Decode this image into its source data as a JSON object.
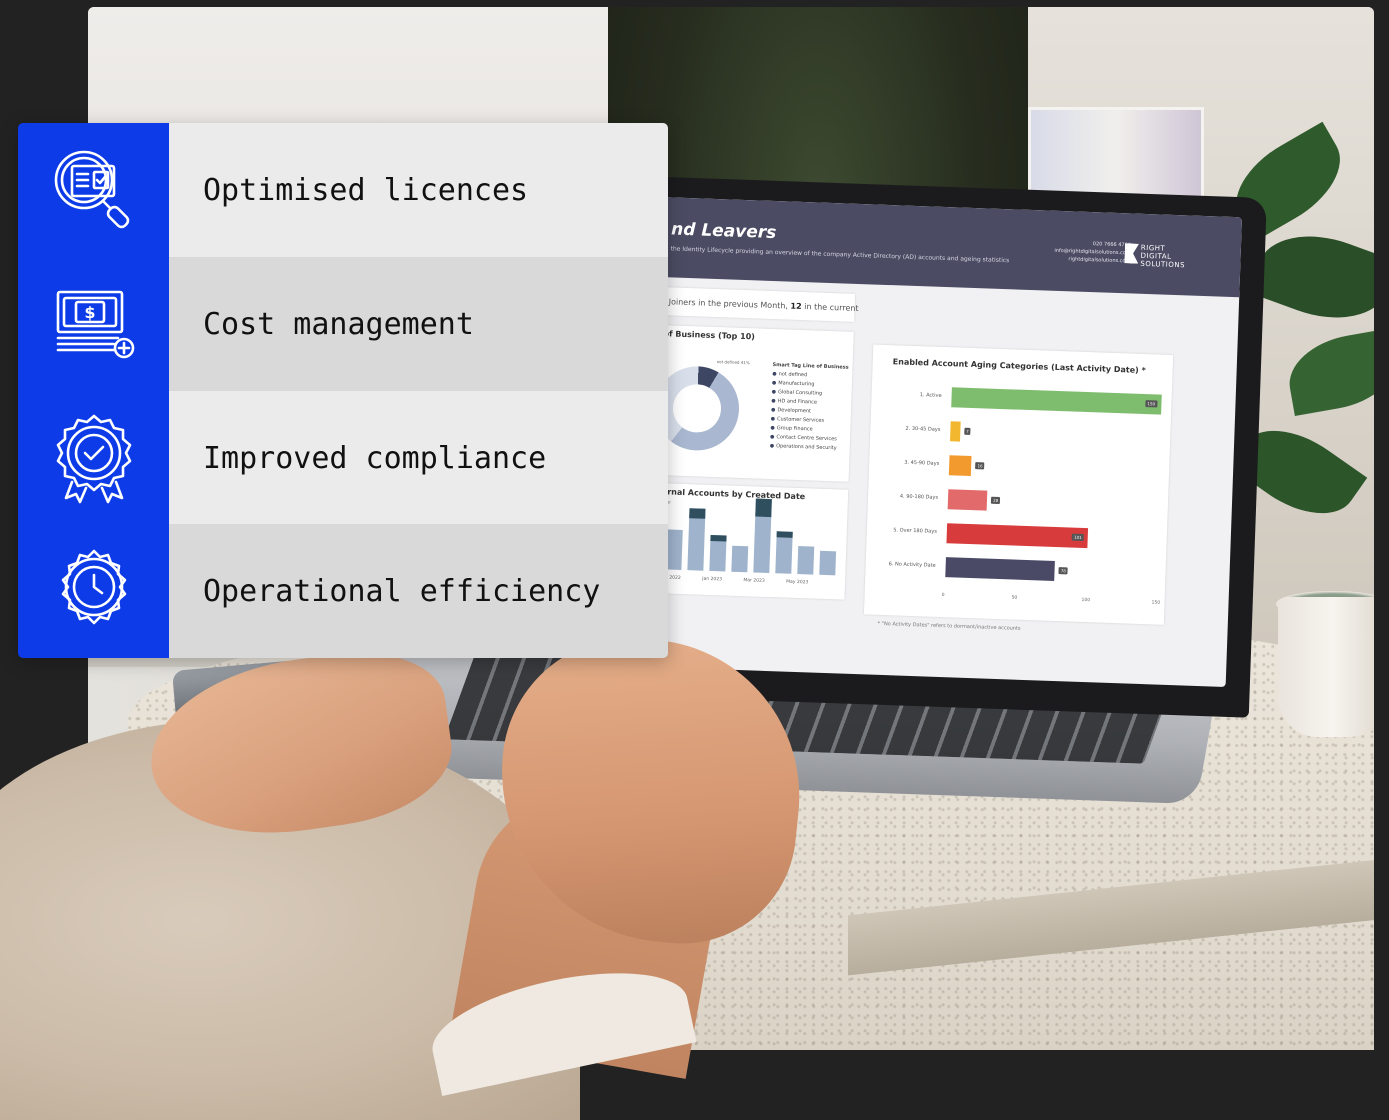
{
  "features": [
    {
      "label": "Optimised licences",
      "icon": "licence-search-icon",
      "bg": "#ebebeb"
    },
    {
      "label": "Cost management",
      "icon": "banknote-add-icon",
      "bg": "#d9d9d9"
    },
    {
      "label": "Improved compliance",
      "icon": "compliance-badge-icon",
      "bg": "#ebebeb"
    },
    {
      "label": "Operational efficiency",
      "icon": "clock-gear-icon",
      "bg": "#d9d9d9"
    }
  ],
  "accent_color": "#0d3be8",
  "laptop_screen": {
    "title": "nd Leavers",
    "subtitle": "the Identity Lifecycle providing an overview of the company Active Directory (AD) accounts and ageing statistics",
    "contact": [
      "020 7666 4700",
      "info@rightdigitalsolutions.com",
      "rightdigitalsolutions.com"
    ],
    "logo": [
      "RIGHT",
      "DIGITAL",
      "SOLUTIONS"
    ],
    "kpi_prefix": "Joiners in the previous Month,",
    "kpi_value": "12",
    "kpi_suffix": "in the current",
    "donut_card_title": "of Business (Top 10)",
    "donut_legend_title": "Smart Tag Line of Business",
    "donut_legend": [
      "not defined",
      "Manufacturing",
      "Global Consulting",
      "HD and Finance",
      "Development",
      "Customer Services",
      "Group Finance",
      "Contact Centre Services",
      "Operations and Security"
    ],
    "donut_side_label": "not defined 41%",
    "columns_card_title": "ternal Accounts by Created Date",
    "columns_legend": "User",
    "columns_axis": [
      "Nov 2022",
      "Jan 2023",
      "Mar 2023",
      "May 2023"
    ],
    "aging_card_title": "Enabled Account Aging Categories (Last Activity Date) *",
    "aging_footnote": "* \"No Activity Dates\" refers to dormant/inactive accounts"
  },
  "chart_data": {
    "type": "bar",
    "title": "Enabled Account Aging Categories (Last Activity Date) *",
    "categories": [
      "1. Active",
      "2. 30-45 Days",
      "3. 45-90 Days",
      "4. 90-180 Days",
      "5. Over 180 Days",
      "6. No Activity Date"
    ],
    "values": [
      150,
      7,
      16,
      28,
      101,
      78
    ],
    "value_labels": [
      "150",
      "7",
      "16",
      "28",
      "101",
      "78"
    ],
    "colors": [
      "#7fbd6e",
      "#f2b72f",
      "#f29a2e",
      "#e36a6a",
      "#d83b3b",
      "#4a4a66"
    ],
    "xlim": [
      0,
      150
    ],
    "x_ticks": [
      "0",
      "50",
      "100",
      "150"
    ]
  }
}
